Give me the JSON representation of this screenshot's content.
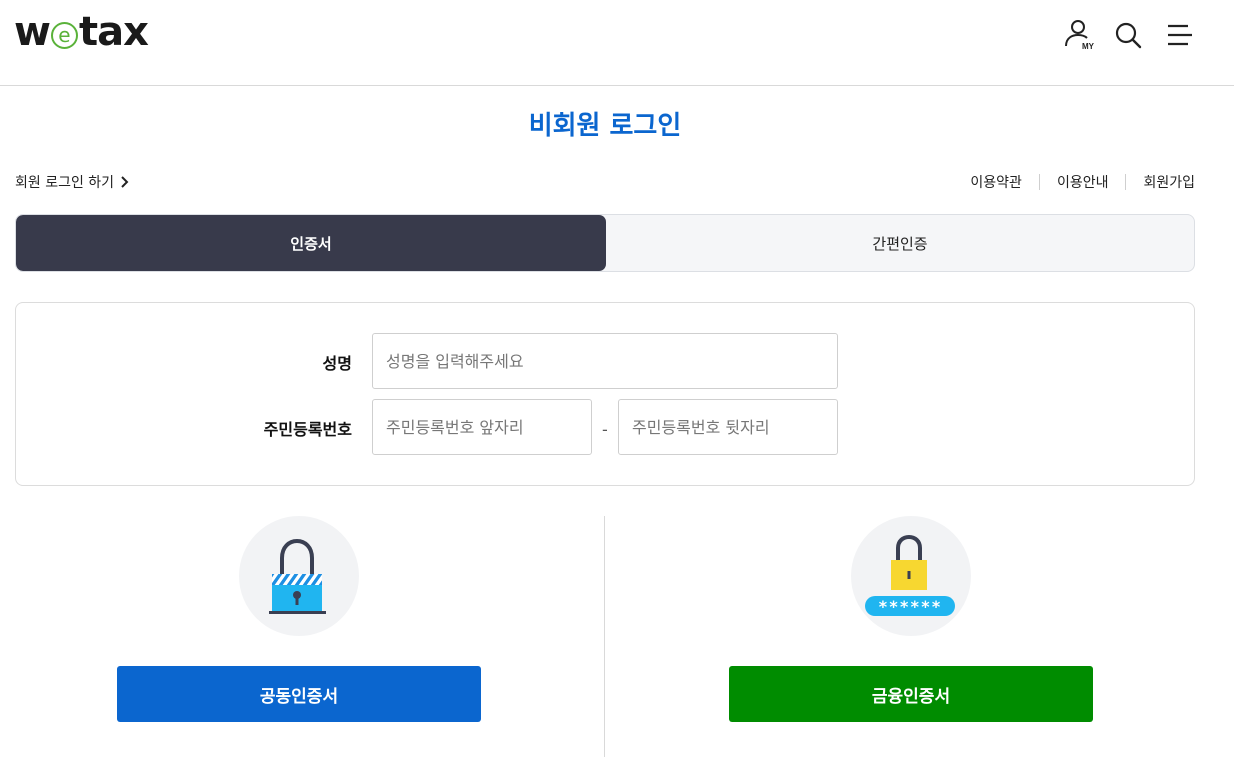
{
  "header": {
    "logo_prefix": "w",
    "logo_e": "e",
    "logo_suffix": "tax",
    "my_icon_label": "MY",
    "icons": [
      "user-my-icon",
      "search-icon",
      "hamburger-menu-icon"
    ]
  },
  "title": "비회원 로그인",
  "member_login_link": "회원 로그인 하기",
  "top_links": [
    "이용약관",
    "이용안내",
    "회원가입"
  ],
  "tabs": [
    {
      "label": "인증서",
      "active": true
    },
    {
      "label": "간편인증",
      "active": false
    }
  ],
  "form": {
    "name_label": "성명",
    "name_placeholder": "성명을 입력해주세요",
    "rrn_label": "주민등록번호",
    "rrn_front_placeholder": "주민등록번호 앞자리",
    "rrn_separator": "-",
    "rrn_back_placeholder": "주민등록번호 뒷자리"
  },
  "panels": {
    "left": {
      "icon": "padlock-icon",
      "button_label": "공동인증서",
      "color": "#0b66cf"
    },
    "right": {
      "icon": "padlock-password-icon",
      "password_mask": "******",
      "button_label": "금융인증서",
      "color": "#008c00"
    }
  },
  "colors": {
    "brand_blue": "#0b66cf",
    "brand_green": "#5ab23a",
    "tab_active_bg": "#383a4b",
    "financial_green": "#008c00"
  }
}
